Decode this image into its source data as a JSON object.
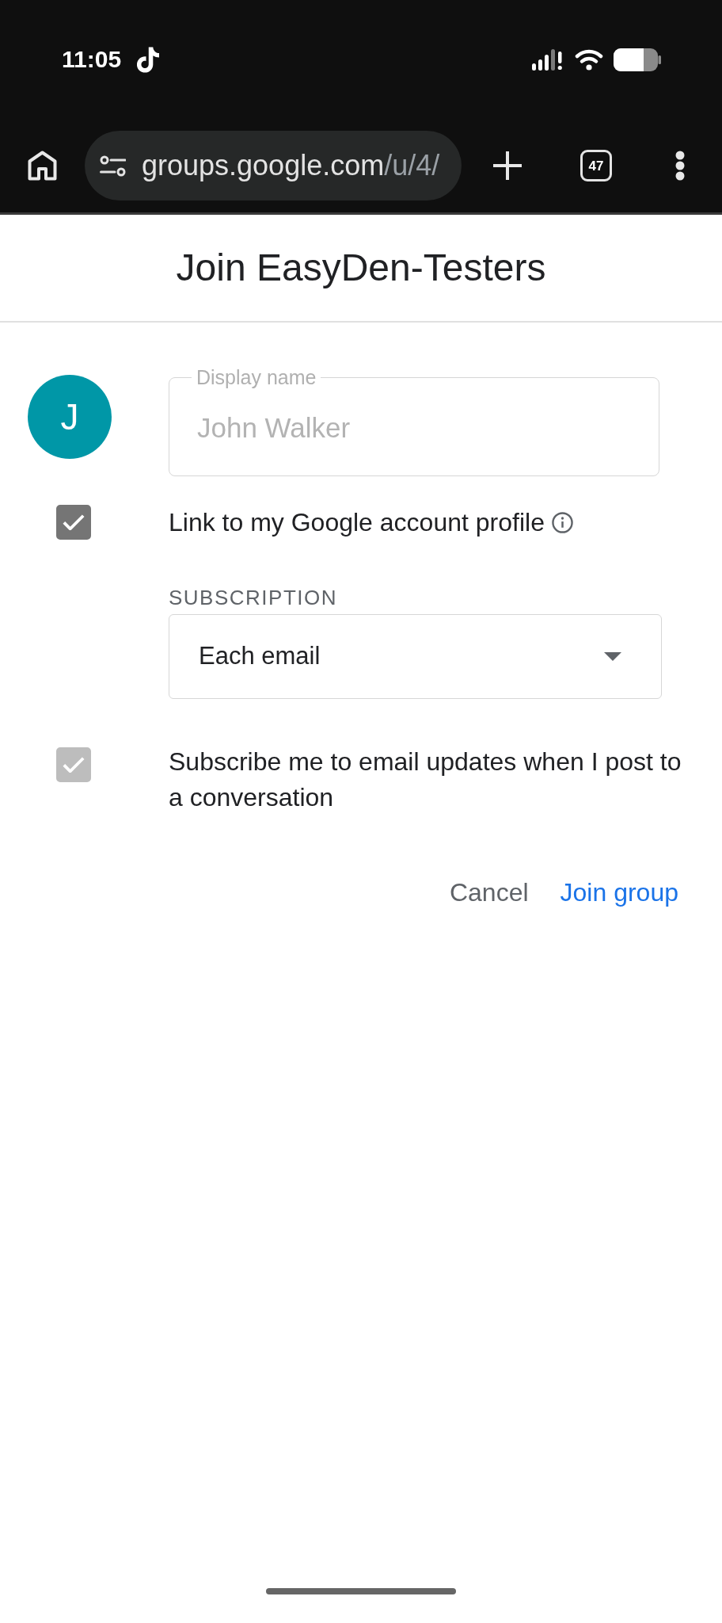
{
  "status_bar": {
    "time": "11:05"
  },
  "browser": {
    "url_host": "groups.google.com",
    "url_path": "/u/4/",
    "tab_count": "47"
  },
  "header": {
    "title": "Join EasyDen-Testers"
  },
  "form": {
    "avatar": {
      "initial": "J"
    },
    "display_name": {
      "label": "Display name",
      "value": "John Walker",
      "disabled": true
    },
    "link_profile": {
      "label": "Link to my Google account profile",
      "checked": true
    },
    "subscription": {
      "label": "SUBSCRIPTION",
      "value": "Each email"
    },
    "self_subscribe": {
      "label": "Subscribe me to email updates when I post to a conversation",
      "checked": true,
      "disabled": true
    }
  },
  "actions": [
    {
      "label": "Cancel",
      "kind": "secondary"
    },
    {
      "label": "Join group",
      "kind": "primary"
    }
  ]
}
